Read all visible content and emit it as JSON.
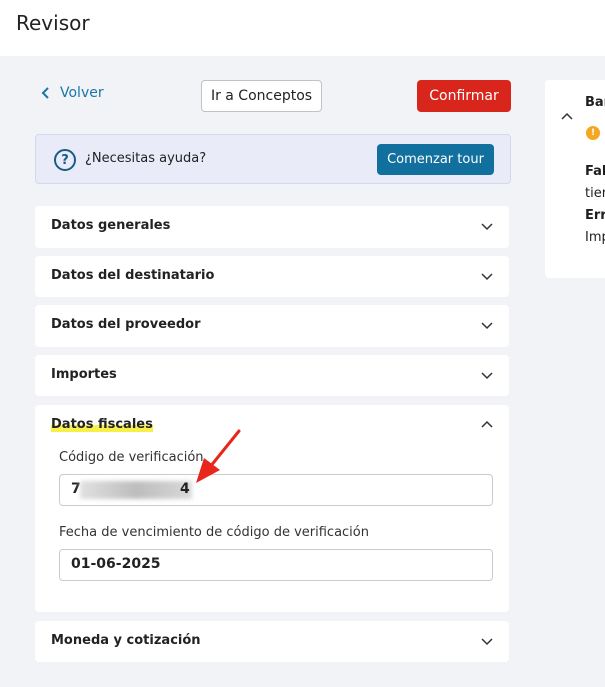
{
  "header": {
    "title": "Revisor"
  },
  "toolbar": {
    "back_label": "Volver",
    "concepts_label": "Ir a Conceptos",
    "confirm_label": "Confirmar"
  },
  "help": {
    "text": "¿Necesitas ayuda?",
    "tour_label": "Comenzar tour"
  },
  "sections": {
    "general": "Datos generales",
    "recipient": "Datos del destinatario",
    "supplier": "Datos del proveedor",
    "amounts": "Importes",
    "fiscal": "Datos fiscales",
    "currency": "Moneda y cotización"
  },
  "fiscal": {
    "code_label": "Código de verificación",
    "code_first": "7",
    "code_last": "4",
    "expiry_label": "Fecha de vencimiento de código de verificación",
    "expiry_value": "01-06-2025"
  },
  "side_card": {
    "title": "Bar",
    "line1": "Fal",
    "line2": "tier",
    "line3": "Err",
    "line4": "Imp"
  },
  "colors": {
    "accent": "#12709f",
    "danger": "#d9261c",
    "highlight": "#f7f04a",
    "annotation_arrow": "#e8261c"
  }
}
